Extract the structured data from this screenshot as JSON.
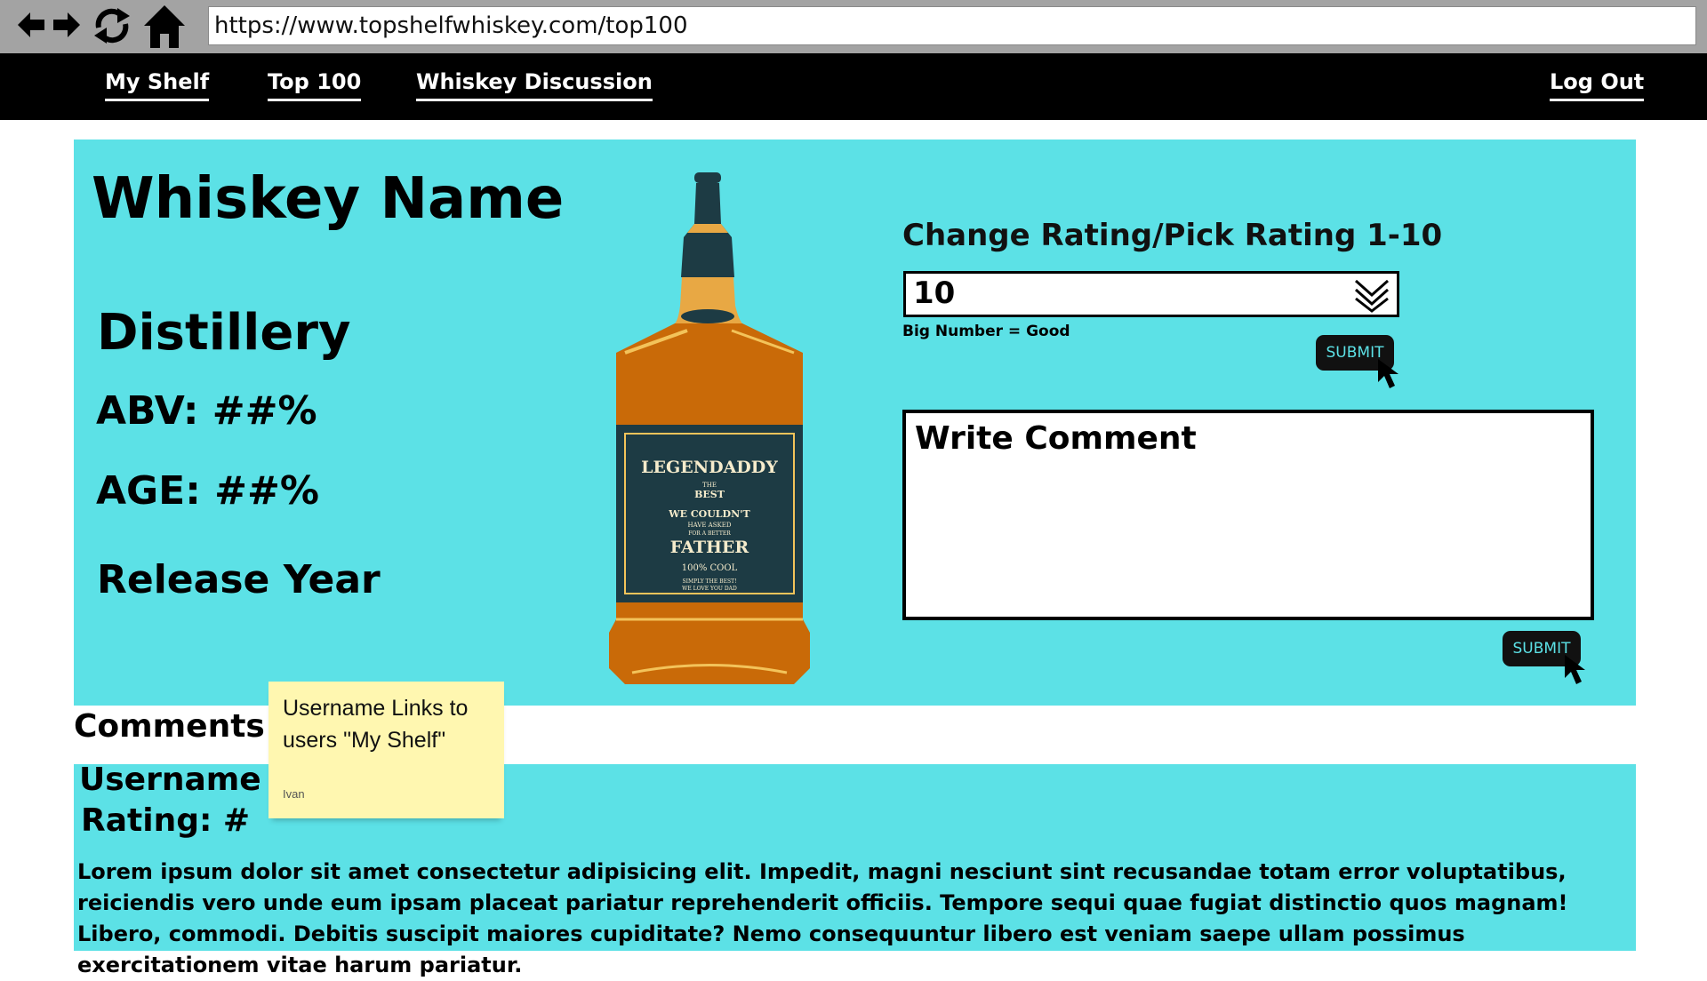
{
  "browser": {
    "url": "https://www.topshelfwhiskey.com/top100",
    "icons": [
      "back-arrow-icon",
      "forward-arrow-icon",
      "refresh-icon",
      "home-icon"
    ]
  },
  "nav": {
    "items": [
      {
        "label": "My Shelf"
      },
      {
        "label": "Top 100"
      },
      {
        "label": "Whiskey Discussion"
      }
    ],
    "logout_label": "Log Out"
  },
  "whiskey": {
    "name": "Whiskey Name",
    "distillery": "Distillery",
    "abv": "ABV: ##%",
    "age": "AGE: ##%",
    "release_year": "Release Year"
  },
  "bottle_label": {
    "brand": "LEGENDADDY",
    "the": "THE",
    "best": "BEST",
    "line1": "WE COULDN'T",
    "line2": "HAVE ASKED",
    "line3": "FOR A BETTER",
    "father": "FATHER",
    "cool": "100% COOL",
    "foot1": "SIMPLY THE BEST!",
    "foot2": "WE LOVE YOU DAD"
  },
  "rating": {
    "label": "Change Rating/Pick Rating  1-10",
    "value": "10",
    "hint": "Big Number = Good",
    "submit_label": "SUBMIT"
  },
  "comment_form": {
    "placeholder": "Write Comment",
    "submit_label": "SUBMIT"
  },
  "comments": {
    "heading": "Comments",
    "items": [
      {
        "username": "Username",
        "rating": "Rating: #",
        "body": "Lorem ipsum dolor sit amet consectetur adipisicing elit. Impedit, magni nesciunt sint recusandae totam error voluptatibus, reiciendis vero unde eum ipsam placeat pariatur reprehenderit officiis. Tempore sequi quae fugiat distinctio quos magnam! Libero, commodi. Debitis suscipit maiores cupiditate? Nemo consequuntur libero est veniam saepe ullam possimus exercitationem vitae harum pariatur."
      }
    ]
  },
  "sticky_note": {
    "text": "Username Links to users \"My Shelf\"",
    "author": "Ivan"
  },
  "colors": {
    "accent": "#5ce1e6",
    "nav_bg": "#000000",
    "browser_bar": "#a3a3a3",
    "sticky": "#fff7b0"
  }
}
